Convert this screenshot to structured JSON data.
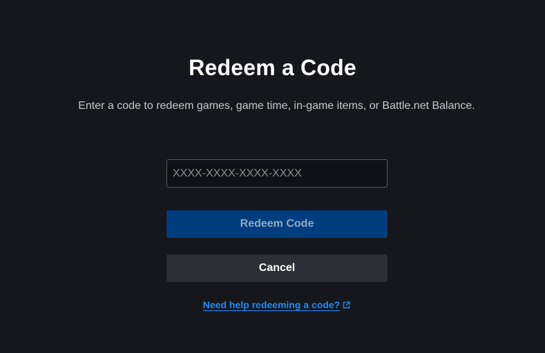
{
  "dialog": {
    "title": "Redeem a Code",
    "description": "Enter a code to redeem games, game time, in-game items, or Battle.net Balance.",
    "code_input": {
      "value": "",
      "placeholder": "XXXX-XXXX-XXXX-XXXX"
    },
    "redeem_button_label": "Redeem Code",
    "cancel_button_label": "Cancel",
    "help_link_label": "Need help redeeming a code?",
    "help_link_icon": "external-link-icon"
  },
  "colors": {
    "background": "#16171d",
    "primary_button_disabled": "#003d7e",
    "secondary_button": "#2d2f34",
    "link": "#148eff"
  }
}
